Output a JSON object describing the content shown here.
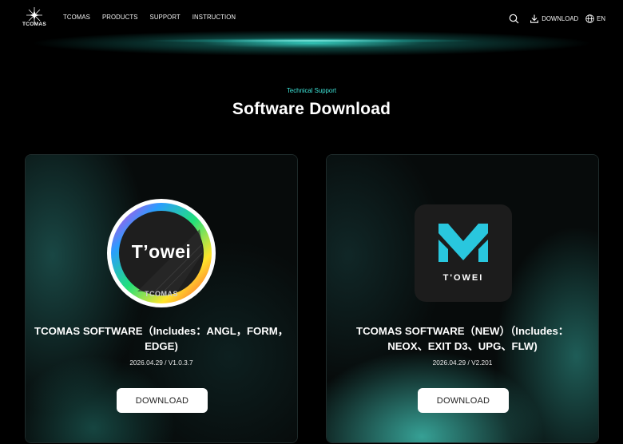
{
  "brand": {
    "logo_text": "TCOMAS"
  },
  "nav": {
    "items": [
      {
        "label": "TCOMAS"
      },
      {
        "label": "PRODUCTS"
      },
      {
        "label": "SUPPORT"
      },
      {
        "label": "INSTRUCTION"
      }
    ]
  },
  "tools": {
    "download_label": "DOWNLOAD",
    "language_label": "EN"
  },
  "hero": {
    "eyebrow": "Technical Support",
    "title": "Software Download"
  },
  "cards": [
    {
      "logo_text": "T’owei",
      "logo_sub": "TCOMAS",
      "title_line1": "TCOMAS SOFTWARE（Includes：ANGL，FORM，",
      "title_line2": "EDGE)",
      "meta": "2026.04.29 / V1.0.3.7",
      "button": "DOWNLOAD"
    },
    {
      "logo_text": "T'OWEI",
      "title_line1": "TCOMAS SOFTWARE（NEW）（Includes：",
      "title_line2": "NEOX、EXIT D3、UPG、FLW)",
      "meta": "2026.04.29 / V2.201",
      "button": "DOWNLOAD"
    }
  ],
  "colors": {
    "accent": "#3ee6da",
    "background": "#000000",
    "button_bg": "#ffffff"
  },
  "icons": [
    "search-icon",
    "download-icon",
    "globe-icon"
  ]
}
